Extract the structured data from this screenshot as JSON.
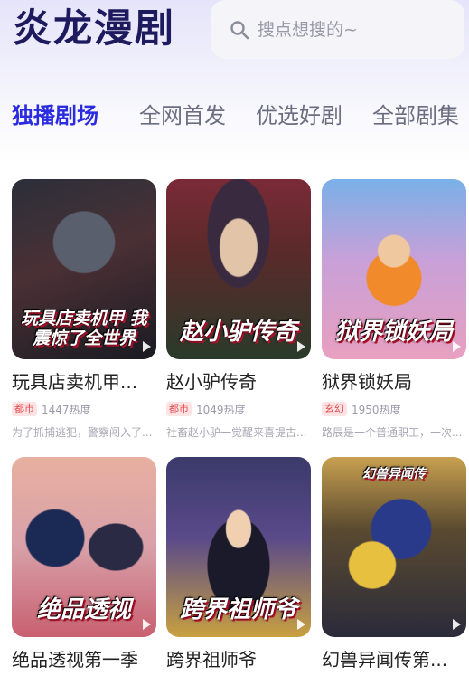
{
  "app": {
    "brand": "炎龙漫剧"
  },
  "search": {
    "placeholder": "搜点想搜的~",
    "icon": "search-icon"
  },
  "tabs": [
    {
      "label": "独播剧场",
      "active": true
    },
    {
      "label": "全网首发",
      "active": false
    },
    {
      "label": "优选好剧",
      "active": false
    },
    {
      "label": "全部剧集",
      "active": false
    }
  ],
  "colors": {
    "brand": "#1d1a5e",
    "active_tab": "#2b2be0",
    "badge_bg": "#fde3e3",
    "badge_text": "#e5484d"
  },
  "dramas": [
    {
      "poster_title": "玩具店卖机甲 我震惊了全世界",
      "title": "玩具店卖机甲...",
      "tag": "都市",
      "heat": "1447热度",
      "desc": "为了抓捕逃犯，警察闯入了...",
      "poster_style": "mech"
    },
    {
      "poster_title": "赵小驴传奇",
      "title": "赵小驴传奇",
      "tag": "都市",
      "heat": "1049热度",
      "desc": "社畜赵小驴一觉醒来喜提古...",
      "poster_style": "zhao"
    },
    {
      "poster_title": "狱界锁妖局",
      "title": "狱界锁妖局",
      "tag": "玄幻",
      "heat": "1950热度",
      "desc": "路辰是一个普通职工，一次...",
      "poster_style": "yu"
    },
    {
      "poster_title": "绝品透视",
      "title": "绝品透视第一季",
      "tag": "",
      "heat": "",
      "desc": "",
      "poster_style": "jue"
    },
    {
      "poster_title": "跨界祖师爷",
      "title": "跨界祖师爷",
      "tag": "",
      "heat": "",
      "desc": "",
      "poster_style": "kua"
    },
    {
      "poster_title": "幻兽异闻传",
      "title": "幻兽异闻传第...",
      "tag": "",
      "heat": "",
      "desc": "",
      "poster_style": "huan"
    }
  ]
}
